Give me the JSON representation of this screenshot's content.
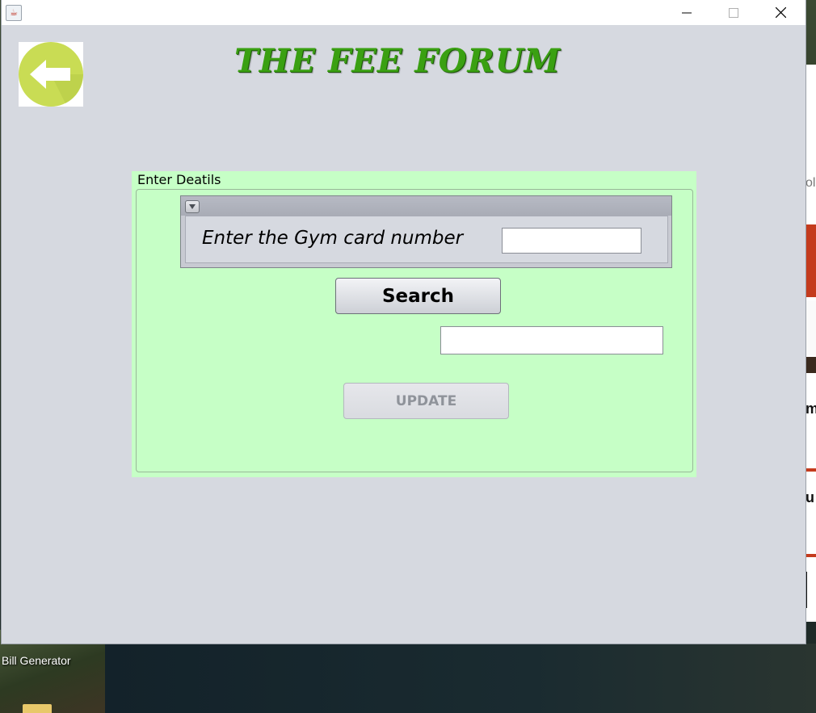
{
  "desktop": {
    "shortcut_label": "Bill Generator",
    "behind_window_fragments": [
      "ol",
      "m",
      "u"
    ]
  },
  "window": {
    "title": "",
    "controls": [
      "minimize",
      "maximize",
      "close"
    ]
  },
  "app": {
    "title": "THE FEE FORUM",
    "title_color": "#3aa012",
    "back_icon": "arrow-left-icon",
    "back_icon_color": "#c9dc54"
  },
  "details": {
    "group_label": "Enter Deatils",
    "panel_color": "#c6ffc6",
    "card_label": "Enter the Gym card number",
    "card_value": "",
    "search_label": "Search",
    "result_value": "",
    "update_label": "UPDATE",
    "update_enabled": false
  }
}
